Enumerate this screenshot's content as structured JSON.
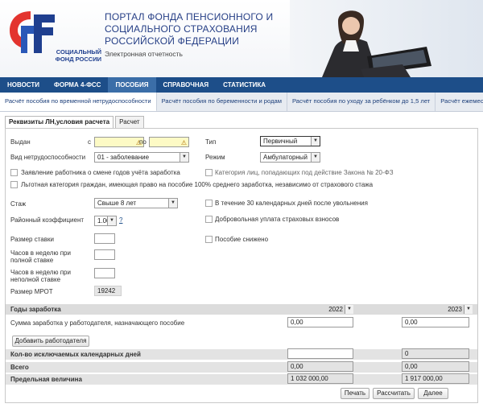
{
  "header": {
    "logo_line1": "СОЦИАЛЬНЫЙ",
    "logo_line2": "ФОНД РОССИИ",
    "title_line1": "ПОРТАЛ ФОНДА ПЕНСИОННОГО И",
    "title_line2": "СОЦИАЛЬНОГО СТРАХОВАНИЯ",
    "title_line3": "РОССИЙСКОЙ ФЕДЕРАЦИИ",
    "subtitle": "Электронная отчетность"
  },
  "nav": [
    {
      "label": "НОВОСТИ"
    },
    {
      "label": "ФОРМА 4-ФСС"
    },
    {
      "label": "ПОСОБИЯ"
    },
    {
      "label": "СПРАВОЧНАЯ"
    },
    {
      "label": "СТАТИСТИКА"
    }
  ],
  "subtabs": [
    {
      "label": "Расчёт пособия по временной нетрудоспособности"
    },
    {
      "label": "Расчёт пособия по беременности и родам"
    },
    {
      "label": "Расчёт пособия по уходу за ребёнком до 1,5 лет"
    },
    {
      "label": "Расчёт ежемеся"
    }
  ],
  "formtabs": [
    {
      "label": "Реквизиты ЛН,условия расчета"
    },
    {
      "label": "Расчет"
    }
  ],
  "form": {
    "issued_label": "Выдан",
    "from_label": "с",
    "to_label": "по",
    "from_value": "",
    "to_value": "",
    "type_label": "Тип",
    "type_value": "Первичный",
    "disability_label": "Вид нетрудоспособности",
    "disability_value": "01 - заболевание",
    "mode_label": "Режим",
    "mode_value": "Амбулаторный",
    "chk_change_years": "Заявление работника о смене годов учёта заработка",
    "chk_category_law": "Категория лиц, попадающих под действие Закона № 20-ФЗ",
    "chk_privileged": "Льготная категория граждан, имеющая право на пособие 100% среднего заработка, независимо от страхового стажа",
    "experience_label": "Стаж",
    "experience_value": "Свыше 8 лет",
    "chk_30days": "В течение 30 календарных дней после увольнения",
    "region_coef_label": "Районный коэффициент",
    "region_coef_value": "1.00",
    "help_mark": "?",
    "chk_voluntary": "Добровольная уплата страховых взносов",
    "rate_size_label": "Размер ставки",
    "chk_reduced": "Пособие снижено",
    "hours_full_label_1": "Часов в неделю при",
    "hours_full_label_2": "полной ставке",
    "hours_part_label_1": "Часов в неделю при",
    "hours_part_label_2": "неполной ставке",
    "mrot_label": "Размер МРОТ",
    "mrot_value": "19242"
  },
  "earnings": {
    "years_label": "Годы заработка",
    "year1": "2022",
    "year2": "2023",
    "sum_label": "Сумма заработка у работодателя, назначающего пособие",
    "sum1": "0,00",
    "sum2": "0,00",
    "add_employer": "Добавить работодателя",
    "excluded_days_label": "Кол-во исключаемых календарных дней",
    "excluded1": "",
    "excluded2": "0",
    "total_label": "Всего",
    "total1": "0,00",
    "total2": "0,00",
    "limit_label": "Предельная величина",
    "limit1": "1 032 000,00",
    "limit2": "1 917 000,00"
  },
  "buttons": {
    "print": "Печать",
    "calculate": "Рассчитать",
    "next": "Далее"
  },
  "colors": {
    "nav_bg": "#1d4e89",
    "nav_active": "#3b6ea8",
    "logo_red": "#e3342f",
    "logo_blue": "#1f3f8f",
    "warning_field": "#fdfac5"
  }
}
